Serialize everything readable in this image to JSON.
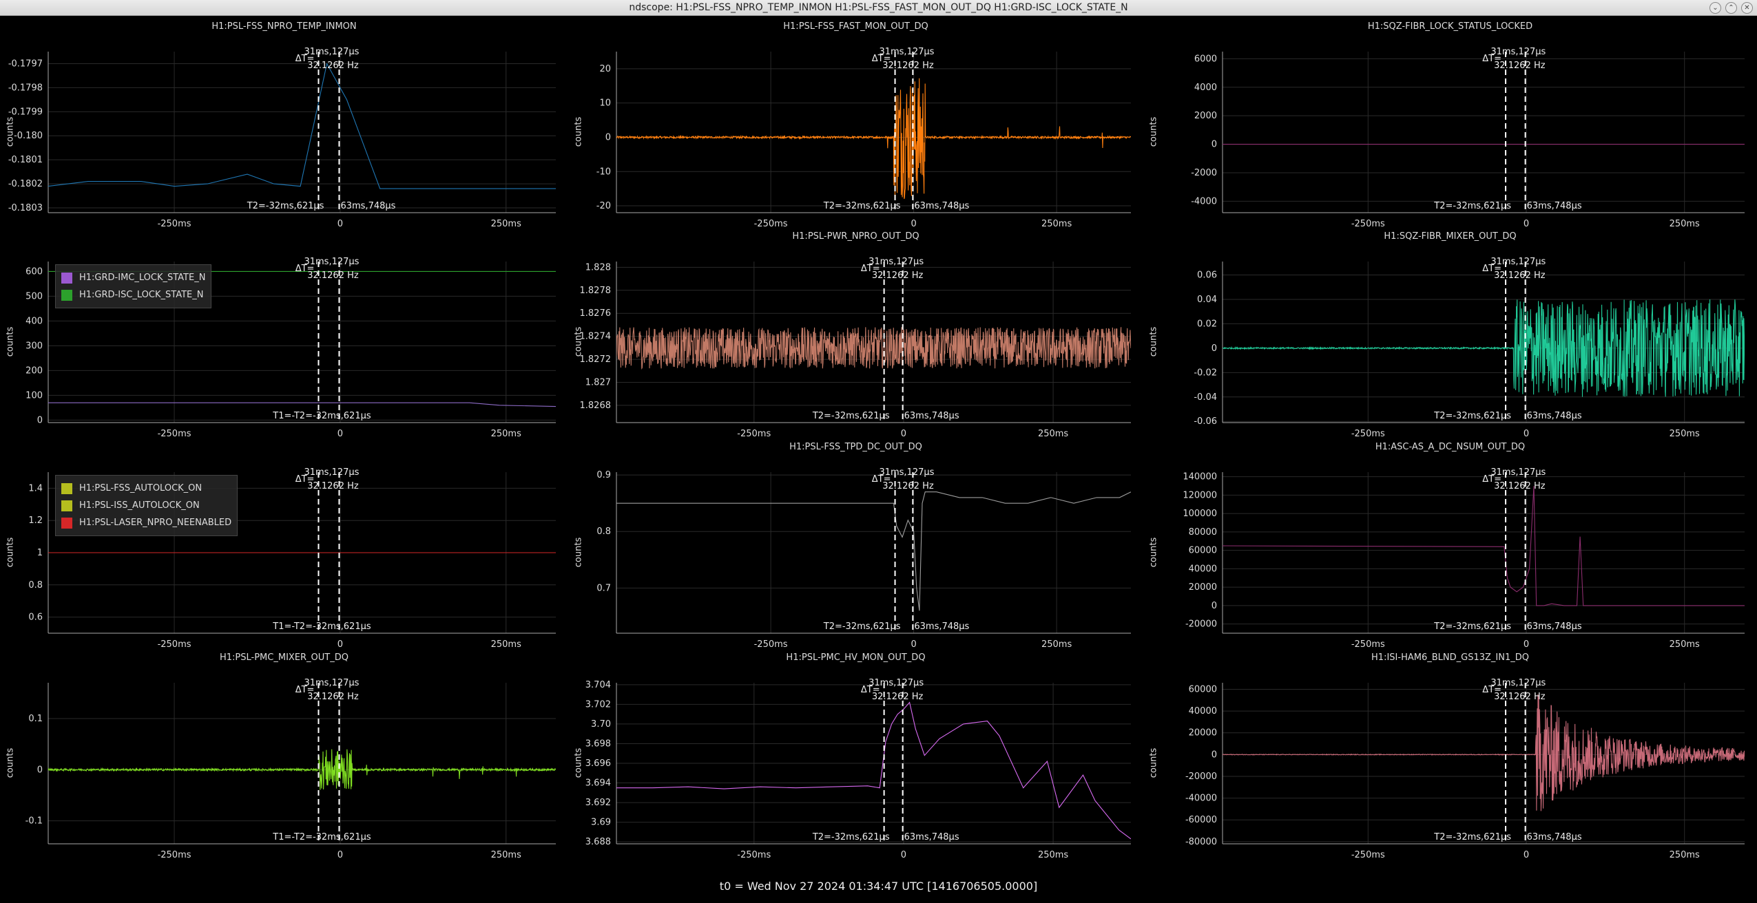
{
  "window": {
    "title": "ndscope: H1:PSL-FSS_NPRO_TEMP_INMON H1:PSL-FSS_FAST_MON_OUT_DQ H1:GRD-ISC_LOCK_STATE_N",
    "buttons": [
      "chevron-down-icon",
      "chevron-up-icon",
      "close-icon"
    ]
  },
  "footer": {
    "text": "t0 = Wed Nov 27 2024 01:34:47 UTC [1416706505.0000]"
  },
  "cursors": {
    "delta_t_label": "ΔT=",
    "delta_t_value": "31ms,127μs",
    "frequency": "32.1262 Hz",
    "t2_label": "T2=-32ms,621μs",
    "t2_right": "63ms,748μs",
    "t1_label": "T1=-T2=-32ms,621μs"
  },
  "shared_x": {
    "ticks": [
      "-250ms",
      "0",
      "250ms"
    ],
    "tick_values": [
      -250,
      0,
      250
    ]
  },
  "colors": {
    "background": "#000000",
    "grid": "#2a2a2a",
    "cursor": "#ffffff"
  },
  "legends": {
    "guardian": [
      {
        "label": "H1:GRD-IMC_LOCK_STATE_N",
        "color": "#9b59d0"
      },
      {
        "label": "H1:GRD-ISC_LOCK_STATE_N",
        "color": "#2ca02c"
      }
    ],
    "autolock": [
      {
        "label": "H1:PSL-FSS_AUTOLOCK_ON",
        "color": "#b5bd1e"
      },
      {
        "label": "H1:PSL-ISS_AUTOLOCK_ON",
        "color": "#b5bd1e"
      },
      {
        "label": "H1:PSL-LASER_NPRO_NEENABLED",
        "color": "#d62728"
      }
    ]
  },
  "chart_data": [
    {
      "type": "line",
      "title": "H1:PSL-FSS_NPRO_TEMP_INMON",
      "ylabel": "counts",
      "ylim": [
        -0.18032,
        -0.17965
      ],
      "yticks": [
        -0.1797,
        -0.1798,
        -0.1799,
        -0.18,
        -0.1801,
        -0.1802,
        -0.1803
      ],
      "ytick_labels": [
        "-0.1797",
        "-0.1798",
        "-0.1799",
        "-0.180",
        "-0.1801",
        "-0.1802",
        "-0.1803"
      ],
      "xlim": [
        -440,
        325
      ],
      "color": "#1f77b4",
      "cursor_mode": "t2",
      "series": [
        {
          "x": [
            -440,
            -380,
            -300,
            -250,
            -200,
            -140,
            -100,
            -60,
            -20,
            10,
            60,
            325
          ],
          "values": [
            -0.18021,
            -0.18019,
            -0.18019,
            -0.18021,
            -0.1802,
            -0.18016,
            -0.1802,
            -0.18021,
            -0.1797,
            -0.17985,
            -0.18022,
            -0.18022
          ]
        }
      ]
    },
    {
      "type": "line",
      "title": "H1:PSL-FSS_FAST_MON_OUT_DQ",
      "ylabel": "counts",
      "ylim": [
        -22,
        25
      ],
      "yticks": [
        20,
        10,
        0,
        -10,
        -20
      ],
      "ytick_labels": [
        "20",
        "10",
        "0",
        "-10",
        "-20"
      ],
      "xlim": [
        -520,
        380
      ],
      "color": "#ff7f0e",
      "cursor_mode": "t2",
      "series": [
        {
          "noise": true,
          "base": 0,
          "quiet_amp": 0.3,
          "bursts": [
            {
              "x0": -35,
              "x1": 20,
              "amp": 18
            }
          ],
          "spikes": [
            {
              "x": -45,
              "amp": 4
            },
            {
              "x": 165,
              "amp": 5
            },
            {
              "x": 255,
              "amp": 5
            },
            {
              "x": 330,
              "amp": 4
            }
          ]
        }
      ]
    },
    {
      "type": "line",
      "title": "H1:SQZ-FIBR_LOCK_STATUS_LOCKED",
      "ylabel": "counts",
      "ylim": [
        -4800,
        6500
      ],
      "yticks": [
        6000,
        4000,
        2000,
        0,
        -2000,
        -4000
      ],
      "ytick_labels": [
        "6000",
        "4000",
        "2000",
        "0",
        "-2000",
        "-4000"
      ],
      "xlim": [
        -480,
        345
      ],
      "color": "#8c2d6e",
      "cursor_mode": "t2",
      "series": [
        {
          "x": [
            -480,
            345
          ],
          "values": [
            0,
            0
          ]
        }
      ]
    },
    {
      "type": "line",
      "title": "",
      "ylabel": "counts",
      "ylim": [
        -10,
        640
      ],
      "yticks": [
        600,
        500,
        400,
        300,
        200,
        100,
        0
      ],
      "ytick_labels": [
        "600",
        "500",
        "400",
        "300",
        "200",
        "100",
        "0"
      ],
      "xlim": [
        -440,
        325
      ],
      "color": "#2ca02c",
      "cursor_mode": "t1",
      "series": [
        {
          "name": "H1:GRD-ISC_LOCK_STATE_N",
          "x": [
            -440,
            325
          ],
          "values": [
            600,
            600
          ],
          "color": "#2ca02c"
        },
        {
          "name": "H1:GRD-IMC_LOCK_STATE_N",
          "x": [
            -440,
            195,
            240,
            325
          ],
          "values": [
            70,
            70,
            60,
            55
          ],
          "color": "#8e6cc8"
        }
      ]
    },
    {
      "type": "line",
      "title": "H1:PSL-PWR_NPRO_OUT_DQ",
      "ylabel": "counts",
      "ylim": [
        1.82665,
        1.82805
      ],
      "yticks": [
        1.828,
        1.8278,
        1.8276,
        1.8274,
        1.8272,
        1.827,
        1.8268
      ],
      "ytick_labels": [
        "1.828",
        "1.8278",
        "1.8276",
        "1.8274",
        "1.8272",
        "1.827",
        "1.8268"
      ],
      "xlim": [
        -480,
        380
      ],
      "color": "#c27a66",
      "cursor_mode": "t2",
      "series": [
        {
          "noise": true,
          "base": 1.8273,
          "quiet_amp": 0.00018,
          "bursts": [],
          "spikes": []
        }
      ]
    },
    {
      "type": "line",
      "title": "H1:SQZ-FIBR_MIXER_OUT_DQ",
      "ylabel": "counts",
      "ylim": [
        -0.061,
        0.071
      ],
      "yticks": [
        0.06,
        0.04,
        0.02,
        0,
        -0.02,
        -0.04,
        -0.06
      ],
      "ytick_labels": [
        "0.06",
        "0.04",
        "0.02",
        "0",
        "-0.02",
        "-0.04",
        "-0.06"
      ],
      "xlim": [
        -480,
        345
      ],
      "color": "#20c997",
      "cursor_mode": "t2",
      "series": [
        {
          "noise": true,
          "base": 0,
          "quiet_amp": 0.0006,
          "bursts": [
            {
              "x0": -20,
              "x1": 345,
              "amp": 0.04
            }
          ],
          "spikes": []
        }
      ]
    },
    {
      "type": "line",
      "title": "",
      "ylabel": "counts",
      "ylim": [
        0.5,
        1.5
      ],
      "yticks": [
        1.4,
        1.2,
        1,
        0.8,
        0.6
      ],
      "ytick_labels": [
        "1.4",
        "1.2",
        "1",
        "0.8",
        "0.6"
      ],
      "xlim": [
        -440,
        325
      ],
      "color": "#d62728",
      "cursor_mode": "t1",
      "series": [
        {
          "name": "H1:PSL-LASER_NPRO_NEENABLED",
          "x": [
            -440,
            325
          ],
          "values": [
            1,
            1
          ],
          "color": "#d62728"
        }
      ]
    },
    {
      "type": "line",
      "title": "H1:PSL-FSS_TPD_DC_OUT_DQ",
      "ylabel": "counts",
      "ylim": [
        0.62,
        0.905
      ],
      "yticks": [
        0.9,
        0.8,
        0.7
      ],
      "ytick_labels": [
        "0.9",
        "0.8",
        "0.7"
      ],
      "xlim": [
        -520,
        380
      ],
      "color": "#9e9e9e",
      "cursor_mode": "t2",
      "series": [
        {
          "x": [
            -520,
            -35,
            -30,
            -20,
            -10,
            0,
            5,
            10,
            15,
            20,
            40,
            80,
            120,
            160,
            200,
            240,
            280,
            320,
            360,
            380
          ],
          "values": [
            0.85,
            0.85,
            0.81,
            0.79,
            0.82,
            0.8,
            0.7,
            0.66,
            0.85,
            0.87,
            0.87,
            0.86,
            0.86,
            0.85,
            0.85,
            0.86,
            0.85,
            0.86,
            0.86,
            0.87
          ]
        }
      ]
    },
    {
      "type": "line",
      "title": "H1:ASC-AS_A_DC_NSUM_OUT_DQ",
      "ylabel": "counts",
      "ylim": [
        -30000,
        145000
      ],
      "yticks": [
        140000,
        120000,
        100000,
        80000,
        60000,
        40000,
        20000,
        0,
        -20000
      ],
      "ytick_labels": [
        "140000",
        "120000",
        "100000",
        "80000",
        "60000",
        "40000",
        "20000",
        "0",
        "-20000"
      ],
      "xlim": [
        -480,
        345
      ],
      "color": "#8c2d6e",
      "cursor_mode": "t2",
      "series": [
        {
          "x": [
            -480,
            -35,
            -30,
            -25,
            -15,
            -5,
            5,
            12,
            16,
            20,
            28,
            40,
            60,
            80,
            85,
            90,
            95,
            345
          ],
          "values": [
            65000,
            64000,
            30000,
            20000,
            15000,
            20000,
            40000,
            130000,
            0,
            0,
            0,
            2000,
            0,
            0,
            75000,
            0,
            0,
            0
          ]
        }
      ]
    },
    {
      "type": "line",
      "title": "H1:PSL-PMC_MIXER_OUT_DQ",
      "ylabel": "counts",
      "ylim": [
        -0.145,
        0.17
      ],
      "yticks": [
        0.1,
        0,
        -0.1
      ],
      "ytick_labels": [
        "0.1",
        "0",
        "-0.1"
      ],
      "xlim": [
        -440,
        325
      ],
      "color": "#7fdc21",
      "cursor_mode": "t1",
      "series": [
        {
          "noise": true,
          "base": 0,
          "quiet_amp": 0.002,
          "bursts": [
            {
              "x0": -32,
              "x1": 18,
              "amp": 0.04
            }
          ],
          "spikes": [
            {
              "x": 40,
              "amp": 0.03
            },
            {
              "x": 140,
              "amp": 0.02
            },
            {
              "x": 180,
              "amp": 0.03
            },
            {
              "x": 215,
              "amp": 0.02
            },
            {
              "x": 265,
              "amp": 0.015
            }
          ]
        }
      ]
    },
    {
      "type": "line",
      "title": "H1:PSL-PMC_HV_MON_OUT_DQ",
      "ylabel": "counts",
      "ylim": [
        3.6878,
        3.7042
      ],
      "yticks": [
        3.704,
        3.702,
        3.7,
        3.698,
        3.696,
        3.694,
        3.692,
        3.69,
        3.688
      ],
      "ytick_labels": [
        "3.704",
        "3.702",
        "3.70",
        "3.698",
        "3.696",
        "3.694",
        "3.692",
        "3.69",
        "3.688"
      ],
      "xlim": [
        -480,
        380
      ],
      "color": "#d86bf2",
      "cursor_mode": "t2",
      "series": [
        {
          "x": [
            -480,
            -420,
            -360,
            -300,
            -240,
            -180,
            -120,
            -60,
            -40,
            -30,
            -20,
            -10,
            0,
            10,
            20,
            35,
            60,
            100,
            140,
            160,
            200,
            240,
            260,
            300,
            320,
            360,
            380
          ],
          "values": [
            3.6935,
            3.6935,
            3.6936,
            3.6934,
            3.6936,
            3.6935,
            3.6936,
            3.6937,
            3.6935,
            3.6982,
            3.7,
            3.701,
            3.7015,
            3.7022,
            3.6995,
            3.6968,
            3.6985,
            3.7,
            3.7003,
            3.6988,
            3.6935,
            3.6962,
            3.6915,
            3.6948,
            3.6922,
            3.6892,
            3.6883
          ]
        }
      ]
    },
    {
      "type": "line",
      "title": "H1:ISI-HAM6_BLND_GS13Z_IN1_DQ",
      "ylabel": "counts",
      "ylim": [
        -82000,
        66000
      ],
      "yticks": [
        60000,
        40000,
        20000,
        0,
        -20000,
        -40000,
        -60000,
        -80000
      ],
      "ytick_labels": [
        "60000",
        "40000",
        "20000",
        "0",
        "-20000",
        "-40000",
        "-60000",
        "-80000"
      ],
      "xlim": [
        -480,
        345
      ],
      "color": "#c86a78",
      "cursor_mode": "t2",
      "series": [
        {
          "noise": true,
          "base": 0,
          "quiet_amp": 300,
          "bursts": [
            {
              "x0": 15,
              "x1": 345,
              "amp": 55000,
              "decay": true
            }
          ],
          "spikes": []
        }
      ]
    }
  ]
}
